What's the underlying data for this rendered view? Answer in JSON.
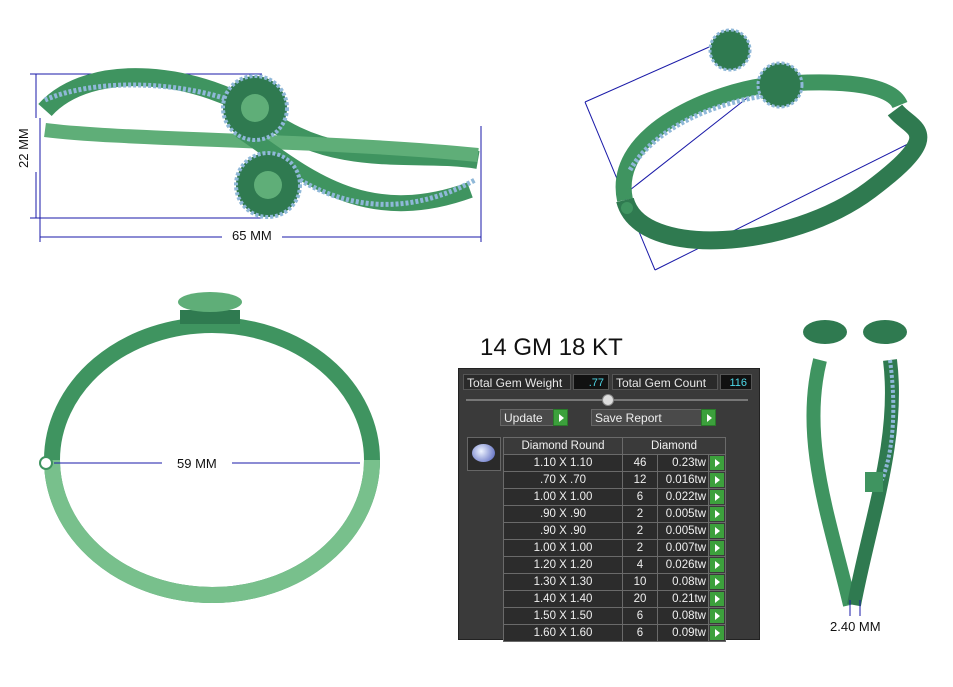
{
  "dimensions": {
    "height_label": "22 MM",
    "length_label": "65 MM",
    "inner_diameter_label": "59 MM",
    "thickness_label": "2.40 MM"
  },
  "metal_spec": "14 GM 18 KT",
  "panel": {
    "total_gem_weight_label": "Total Gem Weight",
    "total_gem_weight_value": ".77",
    "total_gem_count_label": "Total Gem Count",
    "total_gem_count_value": "116",
    "update_label": "Update",
    "save_report_label": "Save Report",
    "table": {
      "col1_header": "Diamond Round",
      "col2_header": "Diamond",
      "rows": [
        {
          "size": "1.10 X 1.10",
          "count": "46",
          "weight": "0.23tw"
        },
        {
          "size": ".70 X .70",
          "count": "12",
          "weight": "0.016tw"
        },
        {
          "size": "1.00 X 1.00",
          "count": "6",
          "weight": "0.022tw"
        },
        {
          "size": ".90 X .90",
          "count": "2",
          "weight": "0.005tw"
        },
        {
          "size": ".90 X .90",
          "count": "2",
          "weight": "0.005tw"
        },
        {
          "size": "1.00 X 1.00",
          "count": "2",
          "weight": "0.007tw"
        },
        {
          "size": "1.20 X 1.20",
          "count": "4",
          "weight": "0.026tw"
        },
        {
          "size": "1.30 X 1.30",
          "count": "10",
          "weight": "0.08tw"
        },
        {
          "size": "1.40 X 1.40",
          "count": "20",
          "weight": "0.21tw"
        },
        {
          "size": "1.50 X 1.50",
          "count": "6",
          "weight": "0.08tw"
        },
        {
          "size": "1.60 X 1.60",
          "count": "6",
          "weight": "0.09tw"
        }
      ]
    }
  },
  "colors": {
    "metal_green": "#3f9460",
    "metal_light": "#78c08c",
    "gem_blue": "#8fb8d8",
    "dimension_line": "#1a1aa8",
    "accent_green": "#3ca03c"
  }
}
